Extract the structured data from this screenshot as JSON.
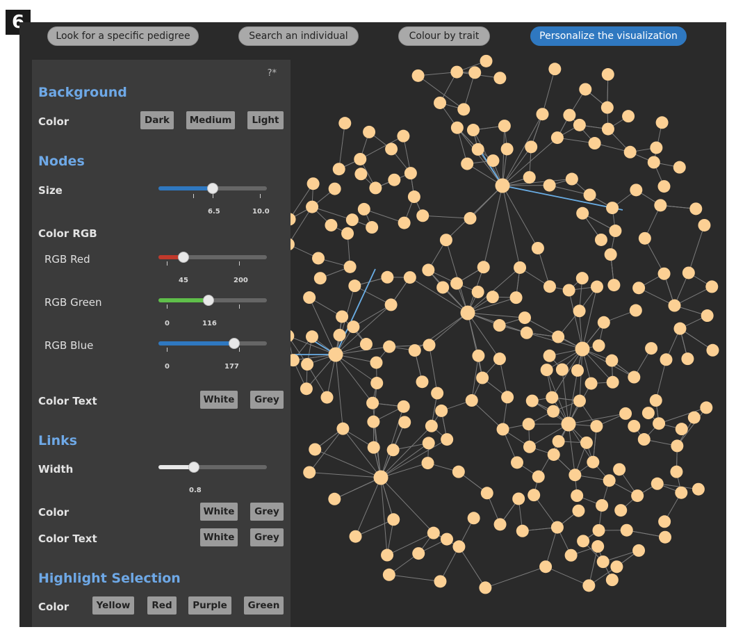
{
  "badge": "6",
  "toolbar": [
    {
      "label": "Look for a specific pedigree",
      "active": false
    },
    {
      "label": "Search an individual",
      "active": false
    },
    {
      "label": "Colour by trait",
      "active": false
    },
    {
      "label": "Personalize the visualization",
      "active": true
    }
  ],
  "panel": {
    "help": "?*",
    "background": {
      "title": "Background",
      "color_label": "Color",
      "options": [
        "Dark",
        "Medium",
        "Light"
      ]
    },
    "nodes": {
      "title": "Nodes",
      "size": {
        "label": "Size",
        "value": 6.5,
        "value_text": "6.5",
        "max_text": "10.0",
        "fraction": 0.5
      },
      "color_rgb_label": "Color RGB",
      "red": {
        "label": "RGB Red",
        "value_text": "45",
        "max_text": "200",
        "fraction": 0.23
      },
      "green": {
        "label": "RGB Green",
        "min_text": "0",
        "value_text": "116",
        "fraction": 0.46
      },
      "blue": {
        "label": "RGB Blue",
        "min_text": "0",
        "value_text": "177",
        "fraction": 0.7
      },
      "color_text_label": "Color Text",
      "color_text_options": [
        "White",
        "Grey"
      ]
    },
    "links": {
      "title": "Links",
      "width": {
        "label": "Width",
        "value_text": "0.8",
        "fraction": 0.33
      },
      "color_label": "Color",
      "color_options": [
        "White",
        "Grey"
      ],
      "color_text_label": "Color Text",
      "color_text_options": [
        "White",
        "Grey"
      ]
    },
    "highlight": {
      "title": "Highlight Selection",
      "color_label": "Color",
      "options": [
        "Yellow",
        "Red",
        "Purple",
        "Green"
      ]
    }
  },
  "colors": {
    "node": "#fcd094",
    "link": "#7b7b7b",
    "highlight_link": "#6aaee6",
    "background": "#2a2a2a",
    "accent": "#6ea8e6"
  }
}
